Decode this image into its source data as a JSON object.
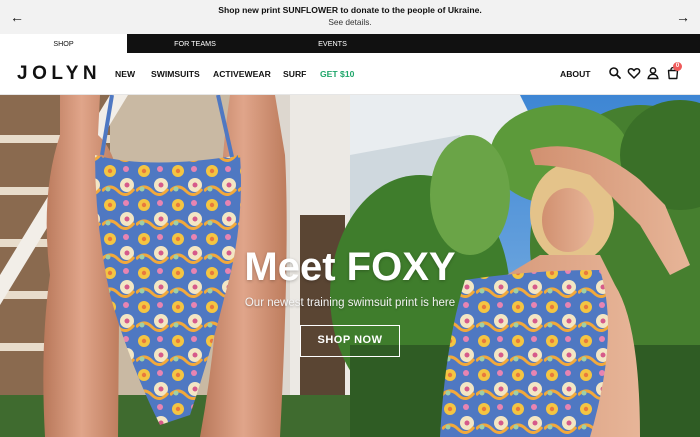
{
  "announcement": {
    "message": "Shop new print SUNFLOWER to donate to the people of Ukraine.",
    "details_link": "See details.",
    "prev_icon": "arrow-left-icon",
    "next_icon": "arrow-right-icon"
  },
  "top_tabs": [
    {
      "label": "SHOP",
      "active": true
    },
    {
      "label": "FOR TEAMS",
      "active": false
    },
    {
      "label": "EVENTS",
      "active": false
    }
  ],
  "nav": {
    "logo": "JOLYN",
    "links": [
      "NEW",
      "SWIMSUITS",
      "ACTIVEWEAR",
      "SURF",
      "GET $10"
    ],
    "about": "ABOUT",
    "icons": [
      "search-icon",
      "heart-icon",
      "account-icon",
      "cart-icon"
    ],
    "cart_count": "0"
  },
  "hero": {
    "title": "Meet FOXY",
    "subtitle": "Our newest training swimsuit print is here",
    "cta": "SHOP NOW"
  },
  "colors": {
    "promo": "#1fa66a",
    "badge": "#ef5b5b",
    "tabs_bg": "#111111"
  }
}
